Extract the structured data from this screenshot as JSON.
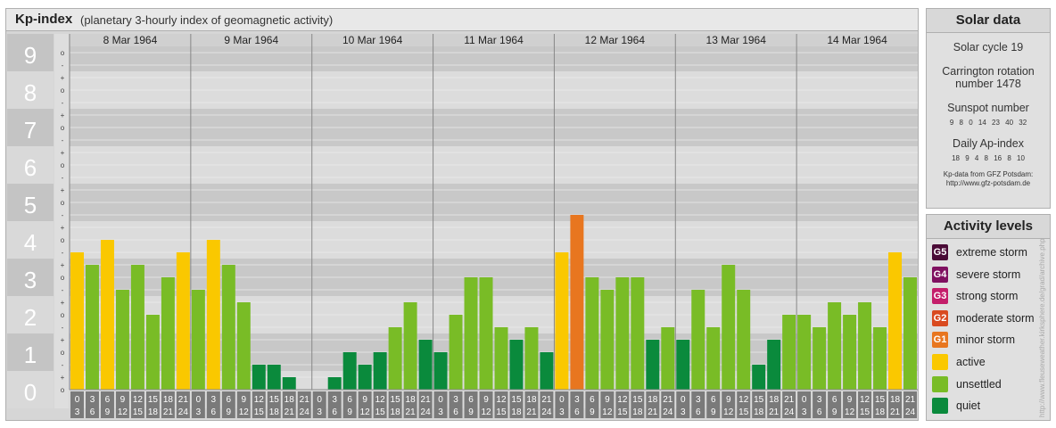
{
  "header": {
    "title": "Kp-index",
    "subtitle": "(planetary 3-hourly index of geomagnetic activity)"
  },
  "chart_data": {
    "type": "bar",
    "ylim": [
      0,
      9
    ],
    "y_tick_labels": [
      "0",
      "1",
      "2",
      "3",
      "4",
      "5",
      "6",
      "7",
      "8",
      "9"
    ],
    "y_minor_labels": [
      "o",
      "+",
      "-",
      "o",
      "+",
      "-",
      "o",
      "+",
      "-",
      "o",
      "+",
      "-",
      "o",
      "+",
      "-",
      "o",
      "+",
      "-",
      "o",
      "+",
      "-",
      "o",
      "+",
      "-",
      "o",
      "+",
      "-",
      "o"
    ],
    "days": [
      "8 Mar 1964",
      "9 Mar 1964",
      "10 Mar 1964",
      "11 Mar 1964",
      "12 Mar 1964",
      "13 Mar 1964",
      "14 Mar 1964"
    ],
    "hour_labels_top": [
      "0",
      "3",
      "6",
      "9",
      "12",
      "15",
      "18",
      "21"
    ],
    "hour_labels_bottom": [
      "3",
      "6",
      "9",
      "12",
      "15",
      "18",
      "21",
      "24"
    ],
    "values": [
      [
        3.667,
        3.333,
        4.0,
        2.667,
        3.333,
        2.0,
        3.0,
        3.667
      ],
      [
        2.667,
        4.0,
        3.333,
        2.333,
        0.667,
        0.667,
        0.333,
        0.0
      ],
      [
        0.0,
        0.333,
        1.0,
        0.667,
        1.0,
        1.667,
        2.333,
        1.333
      ],
      [
        1.0,
        2.0,
        3.0,
        3.0,
        1.667,
        1.333,
        1.667,
        1.0
      ],
      [
        3.667,
        4.667,
        3.0,
        2.667,
        3.0,
        3.0,
        1.333,
        1.667
      ],
      [
        1.333,
        2.667,
        1.667,
        3.333,
        2.667,
        0.667,
        1.333,
        2.0
      ],
      [
        2.0,
        1.667,
        2.333,
        2.0,
        2.333,
        1.667,
        3.667,
        3.0
      ]
    ],
    "level_colors": {
      "quiet": "#0a8a3c",
      "unsettled": "#79bc26",
      "active": "#fac800",
      "minor_storm": "#e8761f",
      "moderate_storm": "#d94a1f",
      "strong_storm": "#c41e6b",
      "severe_storm": "#7f1060",
      "extreme_storm": "#4a0a36"
    }
  },
  "solar_data": {
    "title": "Solar data",
    "solar_cycle": "Solar cycle 19",
    "carrington_line1": "Carrington rotation",
    "carrington_line2": "number 1478",
    "sunspot_title": "Sunspot number",
    "sunspot_values": "9   8   0   14   23   40   32",
    "ap_title": "Daily Ap-index",
    "ap_values": "18   9   4   8   16   8   10",
    "source_line1": "Kp-data from GFZ Potsdam:",
    "source_line2": "http://www.gfz-potsdam.de"
  },
  "activity_levels": {
    "title": "Activity levels",
    "items": [
      {
        "badge": "G5",
        "label": "extreme storm",
        "color": "#4a0a36"
      },
      {
        "badge": "G4",
        "label": "severe storm",
        "color": "#7f1060"
      },
      {
        "badge": "G3",
        "label": "strong storm",
        "color": "#c41e6b"
      },
      {
        "badge": "G2",
        "label": "moderate storm",
        "color": "#d94a1f"
      },
      {
        "badge": "G1",
        "label": "minor storm",
        "color": "#e8761f"
      },
      {
        "badge": "",
        "label": "active",
        "color": "#fac800"
      },
      {
        "badge": "",
        "label": "unsettled",
        "color": "#79bc26"
      },
      {
        "badge": "",
        "label": "quiet",
        "color": "#0a8a3c"
      }
    ]
  },
  "credit": "http://www.fleuseweather.kirksphere.de/grad/archive.php"
}
